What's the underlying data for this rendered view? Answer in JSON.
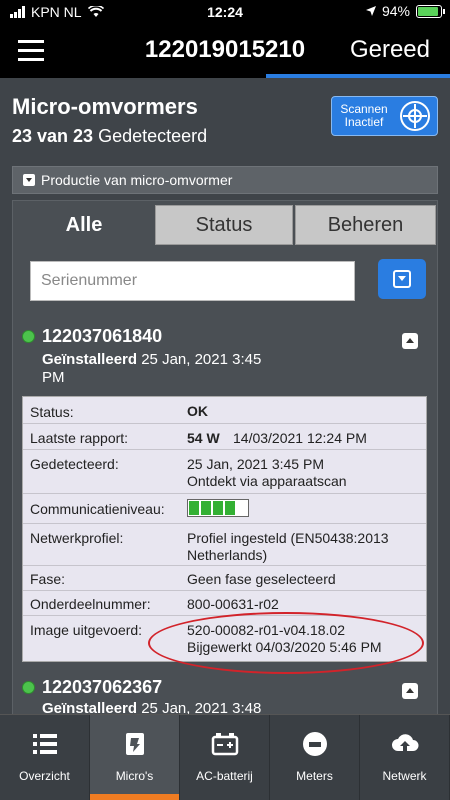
{
  "status_bar": {
    "carrier": "KPN NL",
    "time": "12:24",
    "battery": "94%"
  },
  "header": {
    "title": "122019015210",
    "done": "Gereed"
  },
  "section": {
    "title": "Micro-omvormers",
    "count_bold": "23 van 23",
    "count_text": "Gedetecteerd"
  },
  "scan_button": {
    "label": "Scannen Inactief"
  },
  "production_bar": {
    "label": "Productie van micro-omvormer"
  },
  "tabs": [
    {
      "label": "Alle"
    },
    {
      "label": "Status"
    },
    {
      "label": "Beheren"
    }
  ],
  "search": {
    "placeholder": "Serienummer"
  },
  "devices": [
    {
      "serial": "122037061840",
      "installed_label": "Geïnstalleerd",
      "installed_date": "25 Jan, 2021 3:45",
      "installed_time_suffix": "PM"
    },
    {
      "serial": "122037062367",
      "installed_label": "Geïnstalleerd",
      "installed_date": "25 Jan, 2021 3:48"
    }
  ],
  "details": {
    "status": {
      "label": "Status:",
      "value": "OK"
    },
    "last_report": {
      "label": "Laatste rapport:",
      "power": "54 W",
      "time": "14/03/2021 12:24 PM"
    },
    "detected": {
      "label": "Gedetecteerd:",
      "line1": "25 Jan, 2021 3:45 PM",
      "line2": "Ontdekt via apparaatscan"
    },
    "comm": {
      "label": "Communicatieniveau:",
      "level": 4,
      "max": 5
    },
    "network": {
      "label": "Netwerkprofiel:",
      "line1": "Profiel ingesteld (EN50438:2013",
      "line2": "Netherlands)"
    },
    "phase": {
      "label": "Fase:",
      "value": "Geen fase geselecteerd"
    },
    "part": {
      "label": "Onderdeelnummer:",
      "value": "800-00631-r02"
    },
    "image": {
      "label": "Image uitgevoerd:",
      "line1": "520-00082-r01-v04.18.02",
      "line2": "Bijgewerkt 04/03/2020 5:46 PM"
    }
  },
  "nav": [
    {
      "label": "Overzicht",
      "icon": "list-icon"
    },
    {
      "label": "Micro's",
      "icon": "micro-inverter-icon"
    },
    {
      "label": "AC-batterij",
      "icon": "battery-icon"
    },
    {
      "label": "Meters",
      "icon": "meter-icon"
    },
    {
      "label": "Netwerk",
      "icon": "cloud-upload-icon"
    }
  ],
  "colors": {
    "accent": "#2a7de1",
    "active_nav": "#f07c22",
    "ok_dot": "#4cc34c",
    "highlight_oval": "#d2232a"
  }
}
